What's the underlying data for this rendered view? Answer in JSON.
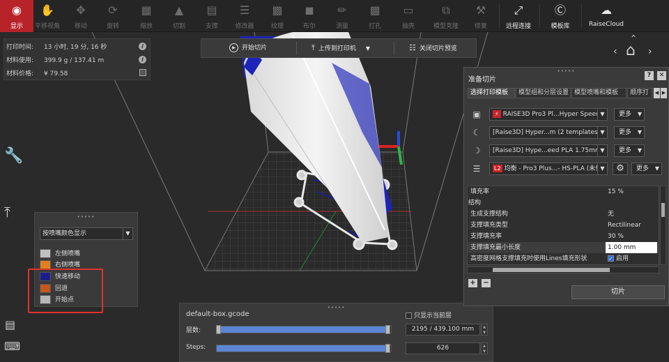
{
  "toolbar": {
    "items": [
      {
        "label": "显示",
        "icon": "eye-icon"
      },
      {
        "label": "平移视角",
        "icon": "hand-icon"
      },
      {
        "label": "移动",
        "icon": "move-icon"
      },
      {
        "label": "旋转",
        "icon": "rotate-icon"
      },
      {
        "label": "缩放",
        "icon": "scale-icon"
      },
      {
        "label": "切割",
        "icon": "cut-icon"
      },
      {
        "label": "支撑",
        "icon": "support-icon"
      },
      {
        "label": "修改器",
        "icon": "modifier-icon"
      },
      {
        "label": "纹理",
        "icon": "texture-icon"
      },
      {
        "label": "布尔",
        "icon": "boolean-icon"
      },
      {
        "label": "测量",
        "icon": "measure-icon"
      },
      {
        "label": "打孔",
        "icon": "hole-icon"
      },
      {
        "label": "抽壳",
        "icon": "shell-icon"
      },
      {
        "label": "模型克隆",
        "icon": "clone-icon"
      },
      {
        "label": "修复",
        "icon": "repair-icon"
      },
      {
        "label": "远程连接",
        "icon": "remote-icon"
      },
      {
        "label": "模板库",
        "icon": "template-icon"
      },
      {
        "label": "RaiseCloud",
        "icon": "cloud-icon"
      }
    ]
  },
  "info": {
    "time_label": "打印时间:",
    "time_value": "13 小时, 19 分, 16 秒",
    "material_label": "材料使用:",
    "material_value": "399.9 g / 137.41 m",
    "price_label": "材料价格:",
    "price_value": "¥ 79.58"
  },
  "slicebar": {
    "start": "开始切片",
    "upload": "上传到打印机",
    "close": "关闭切片预览"
  },
  "legend": {
    "select": "按喷嘴颜色显示",
    "items": [
      {
        "label": "左侧喷嘴",
        "color": "#c0c0c0"
      },
      {
        "label": "右侧喷嘴",
        "color": "#e07f22"
      },
      {
        "label": "快速移动",
        "color": "#1a1f8c"
      },
      {
        "label": "回退",
        "color": "#c4561f"
      },
      {
        "label": "开始点",
        "color": "#b7b7b7"
      }
    ]
  },
  "layers": {
    "filename": "default-box.gcode",
    "only_current": "只显示当前层",
    "layer_label": "层数:",
    "layer_value": "2195 / 439.100 mm",
    "layer_fraction": 1.0,
    "steps_label": "Steps:",
    "steps_value": "626",
    "steps_fraction": 1.0
  },
  "prep": {
    "title": "准备切片",
    "tabs": [
      "选择打印模板",
      "模型组和分层设置",
      "模型喷嘴和模板",
      "顺序打"
    ],
    "printer": "RAISE3D Pro3 Pl...Hyper Speed",
    "filament_left": "[Raise3D] Hyper...m (2 templates)",
    "filament_right": "[Raise3D] Hype...eed PLA 1.75mm",
    "badge": "L2",
    "template": "均衡 - Pro3 Plus...- HS-PLA (未保",
    "more": "更多",
    "settings": [
      {
        "key": "填充率",
        "value": "15 %"
      },
      {
        "key": "结构",
        "value": ""
      },
      {
        "key": "生成支撑结构",
        "value": "无"
      },
      {
        "key": "支撑填充类型",
        "value": "Rectilinear"
      },
      {
        "key": "支撑填充率",
        "value": "30 %"
      },
      {
        "key": "支撑填充最小长度",
        "value": "1.00 mm"
      },
      {
        "key": "高密度网格支撑填充时使用Lines填充形状",
        "value": "启用"
      }
    ],
    "slice_button": "切片"
  },
  "colors": {
    "accent": "#b8232a",
    "slider": "#5b86d6",
    "highlight": "#e0342c"
  }
}
